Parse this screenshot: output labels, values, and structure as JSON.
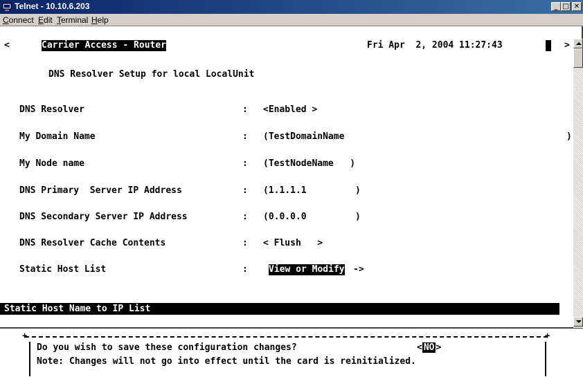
{
  "window": {
    "title": "Telnet - 10.10.6.203",
    "minimize_glyph": "_",
    "maximize_glyph": "□",
    "close_glyph": "✕"
  },
  "menu": {
    "items": [
      {
        "first": "C",
        "rest": "onnect"
      },
      {
        "first": "E",
        "rest": "dit"
      },
      {
        "first": "T",
        "rest": "erminal"
      },
      {
        "first": "H",
        "rest": "elp"
      }
    ]
  },
  "terminal": {
    "left_marker": "<",
    "header_title": "Carrier Access - Router",
    "datetime": "Fri Apr  2, 2004 11:27:43",
    "right_marker": ">",
    "screen_title": "DNS Resolver Setup for local LocalUnit",
    "fields": [
      {
        "label": "DNS Resolver",
        "sep": ":",
        "value": "<Enabled >"
      },
      {
        "label": "My Domain Name",
        "sep": ":",
        "value": "(TestDomainName",
        "tail": ")"
      },
      {
        "label": "My Node name",
        "sep": ":",
        "value": "(TestNodeName   )"
      },
      {
        "label": "DNS Primary  Server IP Address",
        "sep": ":",
        "value": "(1.1.1.1         )"
      },
      {
        "label": "DNS Secondary Server IP Address",
        "sep": ":",
        "value": "(0.0.0.0         )"
      },
      {
        "label": "DNS Resolver Cache Contents",
        "sep": ":",
        "value": "< Flush   >"
      },
      {
        "label": "Static Host List",
        "sep": ":",
        "value": "View or Modify",
        "arrow": "->"
      }
    ],
    "status_line": "Static Host Name to IP List"
  },
  "dialog": {
    "question": "Do you wish to save these configuration changes?",
    "choice_open": "<",
    "choice": "NO",
    "choice_close": ">",
    "note": "Note: Changes will not go into effect until the card is reinitialized.",
    "corner": "+"
  },
  "colors": {
    "titlebar_start": "#0a246a",
    "titlebar_end": "#3a6ea5",
    "terminal_bg": "#ffffff",
    "terminal_fg": "#000000"
  }
}
